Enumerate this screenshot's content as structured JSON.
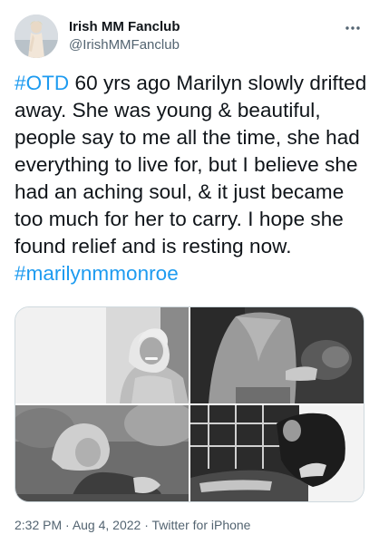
{
  "user": {
    "display_name": "Irish MM Fanclub",
    "handle": "@IrishMMFanclub",
    "avatar_icon": "profile-photo",
    "more_icon": "more-horizontal-icon"
  },
  "tweet": {
    "hashtag_start": "#OTD",
    "body": " 60 yrs ago Marilyn slowly drifted away. She was young & beautiful, people say to me all the time, she had everything to live for, but I believe she had an aching soul, & it just became too much for her to carry. I hope she found relief and is resting now.",
    "hashtag_end": "#marilynmmonroe",
    "link_color": "#1d9bf0"
  },
  "media": {
    "count": 4
  },
  "meta": {
    "time": "2:32 PM",
    "separator": " · ",
    "date": "Aug 4, 2022",
    "source": "Twitter for iPhone"
  }
}
